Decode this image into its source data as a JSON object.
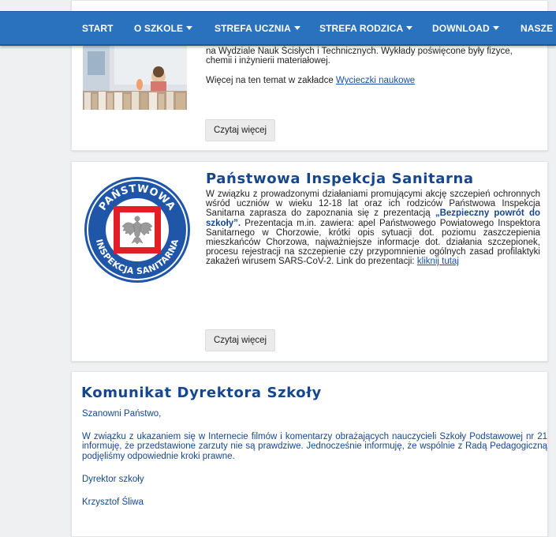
{
  "nav": {
    "items": [
      {
        "label": "START",
        "dropdown": false
      },
      {
        "label": "O SZKOLE",
        "dropdown": true
      },
      {
        "label": "STREFA UCZNIA",
        "dropdown": true
      },
      {
        "label": "STREFA RODZICA",
        "dropdown": true
      },
      {
        "label": "DOWNLOAD",
        "dropdown": true
      },
      {
        "label": "NASZE P",
        "dropdown": false
      }
    ]
  },
  "post1": {
    "line1": "na Wydziale Nauk Ścisłych i Technicznych. Wykłady poświęcone były fizyce,",
    "line2": "chemii i inżynierii materiałowej.",
    "more_prefix": "Więcej na ten temat w zakładce ",
    "more_link": "Wycieczki naukowe",
    "button": "Czytaj więcej"
  },
  "post2": {
    "title": "Państwowa Inspekcja Sanitarna",
    "seal_top": "PAŃSTWOWA",
    "seal_bottom": "INSPEKCJA SANITARNA",
    "body_intro": "W związku z prowadzonymi działaniami promującymi akcję szczepień ochronnych wśród uczniów w wieku 12-18 lat oraz ich rodziców Państwowa Inspekcja Sanitarna zaprasza do zapoznania się z prezentacją ",
    "body_bold": "„Bezpieczny powrót do szkoły”.",
    "body_rest": " Prezentacja m.in. zawiera: apel Państwowego Powiatowego Inspektora Sanitarnego w Chorzowie, krótki opis sytuacji dot. poziomu zaszczepienia mieszkańców Chorzowa, najważniejsze informacje dot. działania szczepionek, procesu rejestracji na szczepienie czy przypomnienie ogólnych zasad profilaktyki zakażeń wirusem SARS-CoV-2. Link do prezentacji: ",
    "link": "kliknij tutaj",
    "button": "Czytaj więcej"
  },
  "post3": {
    "title": "Komunikat Dyrektora Szkoły",
    "greeting": "Szanowni Państwo,",
    "body": "W związku z ukazaniem się w Internecie filmów i komentarzy obrażających nauczycieli Szkoły Podstawowej nr 21 informuję, że przedstawione zarzuty nie są prawdziwe. Jednocześnie informuję, że wspólnie z Radą Pedagogiczną podjęliśmy odpowiednie kroki prawne.",
    "sign_role": "Dyrektor szkoły",
    "sign_name": "Krzysztof Śliwa"
  },
  "colors": {
    "nav_bg": "#2a71be",
    "title": "#15478f",
    "seal_blue": "#1f56a8",
    "seal_red": "#e21f26"
  }
}
